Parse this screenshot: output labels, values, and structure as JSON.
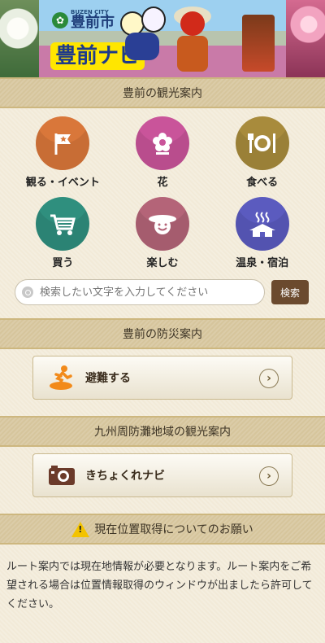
{
  "header": {
    "city_en": "BUZEN CITY",
    "city_jp": "豊前市",
    "app_title": "豊前ナビ",
    "city_logo_icon": "city-emblem-icon"
  },
  "sightseeing": {
    "title": "豊前の観光案内",
    "categories": [
      {
        "label": "観る・イベント",
        "icon": "flag-icon",
        "color": "#d9773a"
      },
      {
        "label": "花",
        "icon": "flower-icon",
        "color": "#c9549a"
      },
      {
        "label": "食べる",
        "icon": "fork-knife-icon",
        "color": "#a88b3c"
      },
      {
        "label": "買う",
        "icon": "cart-icon",
        "color": "#2f8f7e"
      },
      {
        "label": "楽しむ",
        "icon": "smile-hat-icon",
        "color": "#b46478"
      },
      {
        "label": "温泉・宿泊",
        "icon": "onsen-icon",
        "color": "#5b5bbf"
      }
    ]
  },
  "search": {
    "placeholder": "検索したい文字を入力してください",
    "button_label": "検索"
  },
  "disaster": {
    "title": "豊前の防災案内",
    "button_label": "避難する",
    "button_icon": "evacuation-icon"
  },
  "kyushu": {
    "title": "九州周防灘地域の観光案内",
    "button_label": "きちょくれナビ",
    "button_icon": "camera-icon"
  },
  "location": {
    "title": "現在位置取得についてのお願い",
    "warning_mark": "!",
    "text": "ルート案内では現在地情報が必要となります。ルート案内をご希望される場合は位置情報取得のウィンドウが出ましたら許可してください。"
  }
}
